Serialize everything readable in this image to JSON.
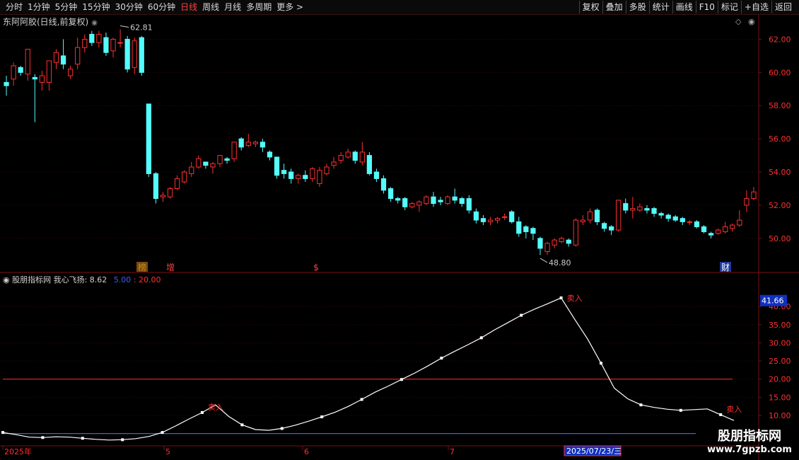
{
  "toolbar": {
    "left": [
      "分时",
      "1分钟",
      "5分钟",
      "15分钟",
      "30分钟",
      "60分钟",
      "日线",
      "周线",
      "月线",
      "多周期",
      "更多 >"
    ],
    "active": "日线",
    "right": [
      "复权",
      "叠加",
      "多股",
      "统计",
      "画线",
      "F10",
      "标记",
      "+自选",
      "返回"
    ]
  },
  "stock": {
    "title": "东阿阿胶(日线,前复权)"
  },
  "indicator": {
    "name": "股朋指标网",
    "label": "我心飞扬: 8.62",
    "ref_low": "5.00",
    "ref_high": "20.00",
    "current": "41.66"
  },
  "watermark": {
    "line1": "股朋指标网",
    "line2": "www.7gpzb.com"
  },
  "colors": {
    "up": "#ff3030",
    "down": "#54fcfc",
    "ref_low": "#3b5cff",
    "ref_high": "#ff3030",
    "grid": "#3a0a0a"
  },
  "chart_data": [
    {
      "type": "candlestick",
      "ylim": [
        48.5,
        63.0
      ],
      "yticks": [
        50,
        52,
        54,
        56,
        58,
        60,
        62
      ],
      "ytick_labels": [
        "50.00",
        "52.00",
        "54.00",
        "56.00",
        "58.00",
        "60.00",
        "62.00"
      ],
      "grid": true,
      "annotations": [
        {
          "text": "62.81",
          "value": 62.81
        },
        {
          "text": "48.80",
          "value": 48.8
        }
      ],
      "markers": [
        "榜",
        "增",
        "$",
        "财"
      ],
      "ohlc": [
        [
          59.4,
          59.2,
          58.6,
          59.8
        ],
        [
          59.6,
          60.4,
          59.2,
          60.6
        ],
        [
          60.3,
          60.0,
          59.8,
          60.4
        ],
        [
          59.9,
          61.4,
          59.5,
          61.4
        ],
        [
          59.7,
          59.6,
          57.0,
          59.9
        ],
        [
          59.4,
          59.8,
          58.9,
          60.1
        ],
        [
          59.4,
          60.7,
          58.9,
          60.7
        ],
        [
          60.6,
          61.2,
          60.2,
          61.4
        ],
        [
          61.0,
          60.5,
          60.2,
          62.0
        ],
        [
          59.8,
          60.2,
          59.6,
          60.4
        ],
        [
          60.5,
          61.5,
          60.2,
          62.1
        ],
        [
          61.5,
          62.0,
          61.2,
          62.3
        ],
        [
          62.3,
          61.8,
          61.6,
          62.5
        ],
        [
          61.8,
          62.3,
          61.5,
          62.5
        ],
        [
          62.1,
          61.2,
          61.0,
          62.4
        ],
        [
          61.3,
          62.0,
          60.9,
          62.1
        ],
        [
          61.8,
          61.8,
          61.5,
          62.6
        ],
        [
          62.0,
          60.2,
          60.0,
          62.2
        ],
        [
          60.3,
          61.9,
          59.9,
          62.1
        ],
        [
          62.1,
          60.0,
          59.8,
          62.2
        ],
        [
          58.1,
          53.9,
          53.7,
          58.1
        ],
        [
          53.9,
          52.4,
          52.1,
          54.0
        ],
        [
          52.5,
          52.6,
          52.2,
          52.8
        ],
        [
          52.5,
          53.0,
          52.4,
          53.1
        ],
        [
          53.0,
          53.6,
          52.9,
          53.8
        ],
        [
          53.4,
          54.0,
          53.3,
          54.1
        ],
        [
          53.9,
          54.3,
          53.7,
          54.6
        ],
        [
          54.3,
          54.8,
          54.2,
          55.0
        ],
        [
          54.6,
          54.4,
          54.2,
          54.6
        ],
        [
          54.3,
          54.5,
          53.9,
          54.6
        ],
        [
          54.5,
          55.0,
          54.3,
          55.0
        ],
        [
          54.8,
          54.7,
          54.5,
          54.9
        ],
        [
          54.8,
          55.8,
          54.6,
          55.8
        ],
        [
          56.0,
          55.5,
          55.3,
          56.1
        ],
        [
          55.6,
          55.8,
          55.5,
          56.3
        ],
        [
          55.7,
          55.8,
          55.5,
          55.9
        ],
        [
          55.8,
          55.5,
          55.2,
          56.0
        ],
        [
          55.2,
          54.9,
          54.7,
          55.3
        ],
        [
          54.9,
          53.8,
          53.6,
          54.9
        ],
        [
          54.1,
          53.9,
          53.6,
          54.5
        ],
        [
          54.0,
          53.6,
          53.3,
          54.2
        ],
        [
          53.6,
          53.8,
          53.3,
          53.9
        ],
        [
          53.8,
          53.6,
          53.4,
          54.1
        ],
        [
          53.6,
          54.2,
          53.4,
          54.3
        ],
        [
          53.3,
          54.1,
          53.1,
          54.3
        ],
        [
          53.9,
          54.3,
          53.8,
          54.5
        ],
        [
          54.4,
          54.6,
          54.2,
          54.9
        ],
        [
          54.7,
          55.0,
          54.5,
          55.2
        ],
        [
          54.9,
          55.2,
          54.8,
          55.4
        ],
        [
          55.2,
          54.7,
          54.5,
          55.3
        ],
        [
          54.6,
          55.2,
          54.4,
          55.8
        ],
        [
          55.0,
          53.9,
          53.8,
          55.2
        ],
        [
          54.0,
          53.6,
          53.4,
          54.2
        ],
        [
          53.6,
          52.9,
          52.7,
          53.8
        ],
        [
          53.0,
          52.4,
          52.2,
          53.1
        ],
        [
          52.4,
          52.3,
          52.1,
          52.5
        ],
        [
          52.4,
          51.9,
          51.7,
          52.5
        ],
        [
          51.9,
          52.1,
          51.8,
          52.2
        ],
        [
          52.0,
          52.2,
          51.6,
          52.3
        ],
        [
          52.1,
          52.5,
          52.0,
          52.6
        ],
        [
          52.5,
          52.1,
          51.9,
          52.8
        ],
        [
          52.3,
          52.2,
          52.0,
          52.5
        ],
        [
          52.1,
          52.5,
          52.0,
          52.6
        ],
        [
          52.5,
          52.3,
          52.1,
          53.0
        ],
        [
          52.4,
          52.1,
          51.9,
          52.5
        ],
        [
          52.4,
          51.7,
          51.5,
          52.6
        ],
        [
          51.6,
          51.1,
          50.9,
          51.8
        ],
        [
          51.2,
          51.0,
          50.8,
          51.4
        ],
        [
          51.0,
          51.1,
          50.8,
          51.3
        ],
        [
          51.1,
          51.2,
          50.9,
          51.3
        ],
        [
          51.3,
          51.3,
          51.1,
          51.5
        ],
        [
          51.6,
          51.0,
          50.9,
          51.7
        ],
        [
          51.0,
          50.3,
          50.1,
          51.3
        ],
        [
          50.7,
          50.4,
          50.0,
          50.8
        ],
        [
          50.6,
          50.3,
          49.9,
          50.7
        ],
        [
          50.0,
          49.4,
          49.0,
          50.1
        ],
        [
          49.2,
          49.7,
          49.0,
          49.8
        ],
        [
          49.6,
          49.9,
          49.4,
          50.0
        ],
        [
          49.8,
          50.0,
          49.7,
          50.1
        ],
        [
          49.9,
          49.7,
          49.5,
          50.0
        ],
        [
          49.6,
          51.1,
          49.5,
          51.2
        ],
        [
          51.0,
          51.1,
          50.8,
          51.4
        ],
        [
          51.1,
          51.6,
          50.9,
          51.8
        ],
        [
          51.7,
          51.0,
          50.8,
          51.8
        ],
        [
          50.9,
          50.6,
          50.4,
          51.0
        ],
        [
          50.7,
          50.5,
          50.2,
          50.8
        ],
        [
          50.5,
          52.3,
          50.4,
          52.3
        ],
        [
          52.1,
          51.7,
          51.5,
          52.4
        ],
        [
          51.7,
          51.8,
          51.2,
          52.5
        ],
        [
          51.7,
          51.9,
          51.6,
          52.1
        ],
        [
          51.8,
          51.7,
          51.5,
          52.0
        ],
        [
          51.8,
          51.5,
          51.3,
          51.9
        ],
        [
          51.5,
          51.4,
          51.2,
          51.6
        ],
        [
          51.4,
          51.2,
          51.0,
          51.5
        ],
        [
          51.3,
          51.1,
          51.0,
          51.4
        ],
        [
          51.2,
          51.0,
          50.8,
          51.3
        ],
        [
          51.0,
          51.0,
          50.8,
          51.1
        ],
        [
          51.0,
          50.7,
          50.6,
          51.1
        ],
        [
          50.7,
          50.4,
          50.3,
          50.8
        ],
        [
          50.3,
          50.2,
          50.0,
          50.4
        ],
        [
          50.3,
          50.5,
          50.2,
          50.6
        ],
        [
          50.4,
          50.7,
          50.3,
          51.0
        ],
        [
          50.6,
          50.8,
          50.4,
          50.9
        ],
        [
          50.8,
          51.1,
          50.7,
          51.7
        ],
        [
          52.0,
          52.4,
          51.6,
          52.9
        ],
        [
          52.4,
          52.8,
          52.3,
          53.1
        ]
      ]
    },
    {
      "type": "line",
      "name": "我心飞扬",
      "x_ticks": [
        "2025年",
        "5",
        "6",
        "7",
        "2025/07/23/三"
      ],
      "ylim": [
        2,
        45.5
      ],
      "yticks": [
        10,
        15,
        20,
        25,
        30,
        35,
        40
      ],
      "ytick_labels": [
        "10.00",
        "15.00",
        "20.00",
        "25.00",
        "30.00",
        "35.00",
        "40.00"
      ],
      "grid": true,
      "ref_lines": [
        5,
        20
      ],
      "annotations": [
        {
          "text": "卖入",
          "value": 10.8
        },
        {
          "text": "卖入",
          "value": 40.8
        },
        {
          "text": "卖入",
          "value": 10.2
        }
      ],
      "values": [
        5.3,
        4.7,
        4.0,
        3.9,
        4.1,
        4.0,
        3.7,
        3.4,
        3.2,
        3.3,
        3.6,
        4.2,
        5.3,
        7.1,
        9.0,
        10.8,
        12.9,
        9.7,
        7.4,
        6.1,
        5.9,
        6.4,
        7.3,
        8.4,
        9.6,
        10.9,
        12.5,
        14.4,
        16.4,
        18.1,
        19.9,
        21.7,
        23.7,
        25.8,
        27.7,
        29.5,
        31.4,
        33.6,
        35.6,
        37.6,
        39.3,
        40.8,
        42.4,
        36.6,
        31.0,
        24.4,
        17.5,
        14.6,
        12.9,
        12.2,
        11.7,
        11.4,
        11.6,
        11.8,
        10.2,
        8.6
      ]
    }
  ]
}
